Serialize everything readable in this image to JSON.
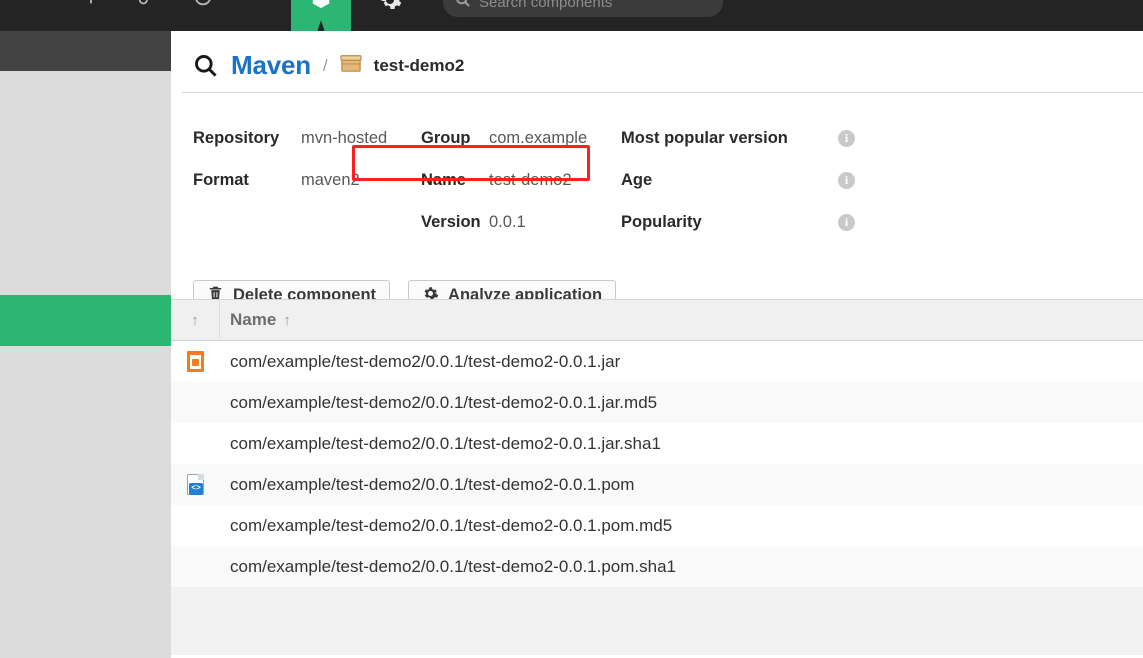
{
  "topbar": {
    "search": {
      "placeholder": "Search components",
      "icon": "search-icon"
    },
    "browse_tab_icon": "browse-box-icon",
    "gear_icon": "gear-icon"
  },
  "breadcrumb": {
    "search_icon": "search-icon",
    "format_link": "Maven",
    "separator": "/",
    "package_icon": "package-icon",
    "component_name": "test-demo2"
  },
  "details": {
    "repository_label": "Repository",
    "repository_value": "mvn-hosted",
    "format_label": "Format",
    "format_value": "maven2",
    "group_label": "Group",
    "group_value": "com.example",
    "name_label": "Name",
    "name_value": "test-demo2",
    "version_label": "Version",
    "version_value": "0.0.1",
    "most_popular_version_label": "Most popular version",
    "age_label": "Age",
    "popularity_label": "Popularity",
    "info_glyph": "i"
  },
  "actions": {
    "delete_label": "Delete component",
    "delete_icon": "trash-icon",
    "analyze_label": "Analyze application",
    "analyze_icon": "gear-icon"
  },
  "table": {
    "header_icon_col": "↑",
    "header_name": "Name",
    "header_sort_arrow": "↑",
    "rows": [
      {
        "icon": "jar-file-icon",
        "name": "com/example/test-demo2/0.0.1/test-demo2-0.0.1.jar"
      },
      {
        "icon": "none",
        "name": "com/example/test-demo2/0.0.1/test-demo2-0.0.1.jar.md5"
      },
      {
        "icon": "none",
        "name": "com/example/test-demo2/0.0.1/test-demo2-0.0.1.jar.sha1"
      },
      {
        "icon": "xml-file-icon",
        "name": "com/example/test-demo2/0.0.1/test-demo2-0.0.1.pom"
      },
      {
        "icon": "none",
        "name": "com/example/test-demo2/0.0.1/test-demo2-0.0.1.pom.md5"
      },
      {
        "icon": "none",
        "name": "com/example/test-demo2/0.0.1/test-demo2-0.0.1.pom.sha1"
      }
    ]
  },
  "annotation": {
    "type": "red-highlight-rectangle",
    "target": "repository-field"
  },
  "colors": {
    "accent_green": "#2bb673",
    "link_blue": "#1a73c7",
    "annotation_red": "#ff1f1f",
    "topbar_dark": "#242424",
    "sidebar_grey": "#dcdcdc"
  }
}
